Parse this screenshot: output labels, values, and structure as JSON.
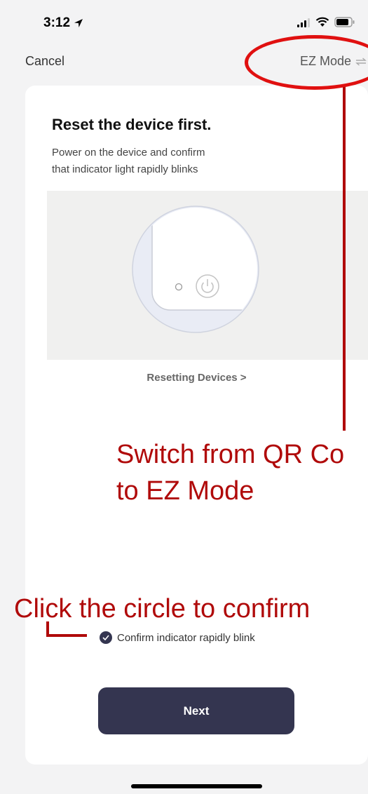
{
  "status_bar": {
    "time": "3:12"
  },
  "nav": {
    "cancel_label": "Cancel",
    "mode_label": "EZ Mode"
  },
  "card": {
    "title": "Reset the device first.",
    "description_line1": "Power on the device and confirm",
    "description_line2": "that indicator light rapidly blinks",
    "resetting_link": "Resetting Devices >",
    "confirm_label": "Confirm indicator rapidly blink",
    "confirm_checked": true,
    "next_label": "Next"
  },
  "annotations": {
    "switch_line1": "Switch from QR Co",
    "switch_line2": "to EZ Mode",
    "click_hint": "Click the circle to confirm",
    "color": "#b00a0a"
  },
  "colors": {
    "accent": "#343550",
    "background": "#f3f3f4",
    "annotation_red": "#e01010"
  },
  "icons": [
    "location-arrow-icon",
    "signal-icon",
    "wifi-icon",
    "battery-icon",
    "swap-arrows-icon",
    "checkmark-icon",
    "power-icon"
  ]
}
